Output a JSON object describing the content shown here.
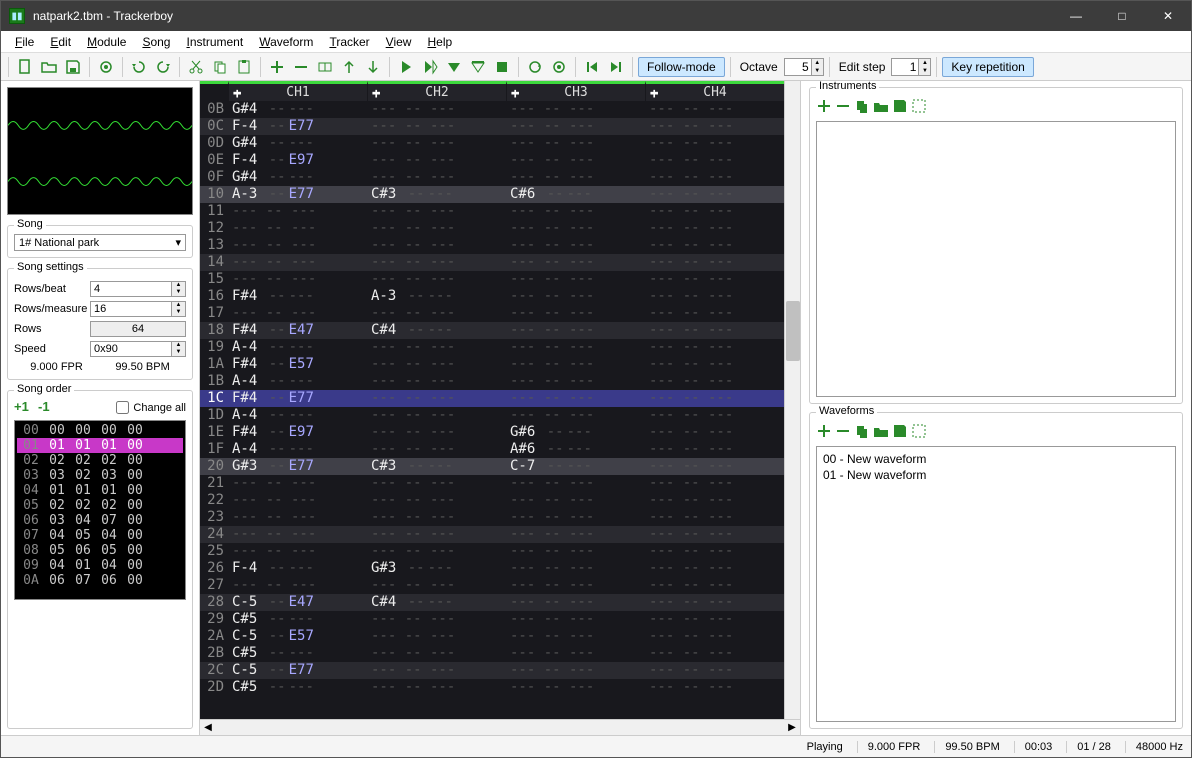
{
  "window": {
    "title": "natpark2.tbm - Trackerboy"
  },
  "menu": [
    "File",
    "Edit",
    "Module",
    "Song",
    "Instrument",
    "Waveform",
    "Tracker",
    "View",
    "Help"
  ],
  "toolbar": {
    "follow_mode": "Follow-mode",
    "octave_label": "Octave",
    "octave_value": "5",
    "edit_step_label": "Edit step",
    "edit_step_value": "1",
    "key_rep": "Key repetition"
  },
  "song": {
    "group_label": "Song",
    "selected": "1# National park"
  },
  "settings": {
    "group_label": "Song settings",
    "rows_beat_label": "Rows/beat",
    "rows_beat": "4",
    "rows_measure_label": "Rows/measure",
    "rows_measure": "16",
    "rows_label": "Rows",
    "rows": "64",
    "speed_label": "Speed",
    "speed": "0x90",
    "fpr": "9.000 FPR",
    "bpm": "99.50 BPM"
  },
  "order": {
    "group_label": "Song order",
    "change_all": "Change all",
    "rows": [
      {
        "idx": "00",
        "cells": [
          "00",
          "00",
          "00",
          "00"
        ]
      },
      {
        "idx": "01",
        "cells": [
          "01",
          "01",
          "01",
          "00"
        ],
        "selected": true
      },
      {
        "idx": "02",
        "cells": [
          "02",
          "02",
          "02",
          "00"
        ]
      },
      {
        "idx": "03",
        "cells": [
          "03",
          "02",
          "03",
          "00"
        ]
      },
      {
        "idx": "04",
        "cells": [
          "01",
          "01",
          "01",
          "00"
        ]
      },
      {
        "idx": "05",
        "cells": [
          "02",
          "02",
          "02",
          "00"
        ]
      },
      {
        "idx": "06",
        "cells": [
          "03",
          "04",
          "07",
          "00"
        ]
      },
      {
        "idx": "07",
        "cells": [
          "04",
          "05",
          "04",
          "00"
        ]
      },
      {
        "idx": "08",
        "cells": [
          "05",
          "06",
          "05",
          "00"
        ]
      },
      {
        "idx": "09",
        "cells": [
          "04",
          "01",
          "04",
          "00"
        ]
      },
      {
        "idx": "0A",
        "cells": [
          "06",
          "07",
          "06",
          "00"
        ]
      }
    ]
  },
  "channels": [
    "CH1",
    "CH2",
    "CH3",
    "CH4"
  ],
  "pattern": [
    {
      "rn": "0B",
      "c1": {
        "note": "G#4"
      }
    },
    {
      "rn": "0C",
      "c1": {
        "note": "F-4",
        "eff": "E77"
      },
      "hl": 1
    },
    {
      "rn": "0D",
      "c1": {
        "note": "G#4"
      }
    },
    {
      "rn": "0E",
      "c1": {
        "note": "F-4",
        "eff": "E97"
      }
    },
    {
      "rn": "0F",
      "c1": {
        "note": "G#4"
      }
    },
    {
      "rn": "10",
      "c1": {
        "note": "A-3",
        "eff": "E77"
      },
      "c2": {
        "note": "C#3"
      },
      "c3": {
        "note": "C#6"
      },
      "hl": 2,
      "play": true
    },
    {
      "rn": "11"
    },
    {
      "rn": "12"
    },
    {
      "rn": "13"
    },
    {
      "rn": "14",
      "hl": 1
    },
    {
      "rn": "15"
    },
    {
      "rn": "16",
      "c1": {
        "note": "F#4"
      },
      "c2": {
        "note": "A-3"
      }
    },
    {
      "rn": "17"
    },
    {
      "rn": "18",
      "c1": {
        "note": "F#4",
        "eff": "E47"
      },
      "c2": {
        "note": "C#4"
      },
      "hl": 1
    },
    {
      "rn": "19",
      "c1": {
        "note": "A-4"
      }
    },
    {
      "rn": "1A",
      "c1": {
        "note": "F#4",
        "eff": "E57"
      }
    },
    {
      "rn": "1B",
      "c1": {
        "note": "A-4"
      }
    },
    {
      "rn": "1C",
      "c1": {
        "note": "F#4",
        "eff": "E77"
      },
      "cursor": true
    },
    {
      "rn": "1D",
      "c1": {
        "note": "A-4"
      }
    },
    {
      "rn": "1E",
      "c1": {
        "note": "F#4",
        "eff": "E97"
      },
      "c3": {
        "note": "G#6"
      }
    },
    {
      "rn": "1F",
      "c1": {
        "note": "A-4"
      },
      "c3": {
        "note": "A#6"
      }
    },
    {
      "rn": "20",
      "c1": {
        "note": "G#3",
        "eff": "E77"
      },
      "c2": {
        "note": "C#3"
      },
      "c3": {
        "note": "C-7"
      },
      "hl": 2,
      "play": true
    },
    {
      "rn": "21"
    },
    {
      "rn": "22"
    },
    {
      "rn": "23"
    },
    {
      "rn": "24",
      "hl": 1
    },
    {
      "rn": "25"
    },
    {
      "rn": "26",
      "c1": {
        "note": "F-4"
      },
      "c2": {
        "note": "G#3"
      }
    },
    {
      "rn": "27"
    },
    {
      "rn": "28",
      "c1": {
        "note": "C-5",
        "eff": "E47"
      },
      "c2": {
        "note": "C#4"
      },
      "hl": 1
    },
    {
      "rn": "29",
      "c1": {
        "note": "C#5"
      }
    },
    {
      "rn": "2A",
      "c1": {
        "note": "C-5",
        "eff": "E57"
      }
    },
    {
      "rn": "2B",
      "c1": {
        "note": "C#5"
      }
    },
    {
      "rn": "2C",
      "c1": {
        "note": "C-5",
        "eff": "E77"
      },
      "hl": 1
    },
    {
      "rn": "2D",
      "c1": {
        "note": "C#5"
      }
    }
  ],
  "instruments": {
    "label": "Instruments"
  },
  "waveforms": {
    "label": "Waveforms",
    "items": [
      "00 - New waveform",
      "01 - New waveform"
    ]
  },
  "status": {
    "playing": "Playing",
    "fpr": "9.000 FPR",
    "bpm": "99.50 BPM",
    "time": "00:03",
    "pos": "01 / 28",
    "rate": "48000 Hz"
  }
}
